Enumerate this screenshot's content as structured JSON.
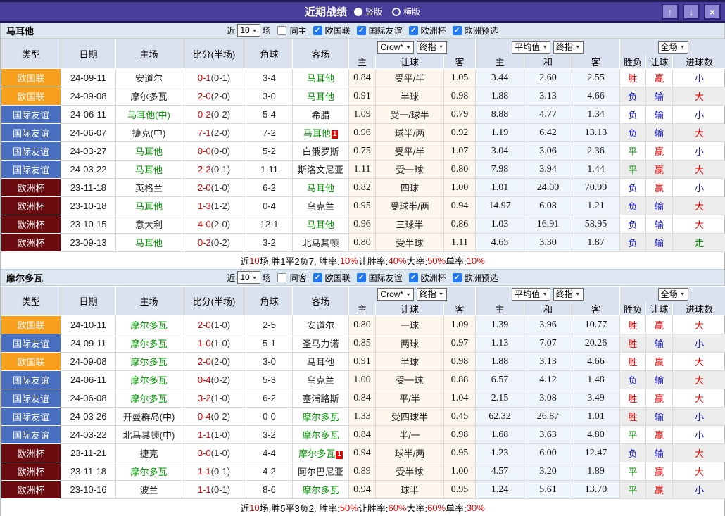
{
  "titlebar": {
    "title": "近期战绩",
    "radio_vertical": "竖版",
    "radio_horizontal": "横版",
    "up_button": "↑",
    "down_button": "↓",
    "close_button": "×"
  },
  "selects": {
    "near_count": "10",
    "crow": "Crow*",
    "final": "终指",
    "avg": "平均值",
    "scope": "全场"
  },
  "filter": {
    "near_label": "近",
    "games_label": "场",
    "leagues": [
      "欧国联",
      "国际友谊",
      "欧洲杯",
      "欧洲预选"
    ]
  },
  "header_labels": {
    "col_type": "类型",
    "col_date": "日期",
    "col_home": "主场",
    "col_score": "比分(半场)",
    "col_corner": "角球",
    "col_away": "客场",
    "sub": [
      "主",
      "让球",
      "客",
      "主",
      "和",
      "客",
      "胜负",
      "让球",
      "进球数"
    ]
  },
  "colors": {
    "titlebar_purple": "#483d9b",
    "league": {
      "欧国联": "#f8a01d",
      "国际友谊": "#4a6fc0",
      "欧洲杯": "#6b0d10"
    },
    "red": "#e60000",
    "blue": "#1414cc",
    "green": "#008800",
    "focal_green": "#009900"
  },
  "tables": [
    {
      "team": "马耳他",
      "same_label": "同主",
      "rows": [
        {
          "lg": "欧国联",
          "d": "24-09-11",
          "h": "安道尔",
          "s": "0-1",
          "sh": "(0-1)",
          "cn": "3-4",
          "a": "马耳他",
          "o": [
            "0.84",
            "受平/半",
            "1.05"
          ],
          "av": [
            "3.44",
            "2.60",
            "2.55"
          ],
          "r": [
            "胜",
            "赢",
            "小"
          ]
        },
        {
          "lg": "欧国联",
          "d": "24-09-08",
          "h": "摩尔多瓦",
          "s": "2-0",
          "sh": "(2-0)",
          "cn": "3-0",
          "a": "马耳他",
          "o": [
            "0.91",
            "半球",
            "0.98"
          ],
          "av": [
            "1.88",
            "3.13",
            "4.66"
          ],
          "r": [
            "负",
            "输",
            "大"
          ]
        },
        {
          "lg": "国际友谊",
          "d": "24-06-11",
          "h": "马耳他(中)",
          "s": "0-2",
          "sh": "(0-2)",
          "cn": "5-4",
          "a": "希腊",
          "o": [
            "1.09",
            "受一/球半",
            "0.79"
          ],
          "av": [
            "8.88",
            "4.77",
            "1.34"
          ],
          "r": [
            "负",
            "输",
            "小"
          ]
        },
        {
          "lg": "国际友谊",
          "d": "24-06-07",
          "h": "捷克(中)",
          "s": "7-1",
          "sh": "(2-0)",
          "cn": "7-2",
          "a": "马耳他",
          "ab": "1",
          "o": [
            "0.96",
            "球半/两",
            "0.92"
          ],
          "av": [
            "1.19",
            "6.42",
            "13.13"
          ],
          "r": [
            "负",
            "输",
            "大"
          ]
        },
        {
          "lg": "国际友谊",
          "d": "24-03-27",
          "h": "马耳他",
          "s": "0-0",
          "sh": "(0-0)",
          "cn": "5-2",
          "a": "白俄罗斯",
          "o": [
            "0.75",
            "受平/半",
            "1.07"
          ],
          "av": [
            "3.04",
            "3.06",
            "2.36"
          ],
          "r": [
            "平",
            "赢",
            "小"
          ]
        },
        {
          "lg": "国际友谊",
          "d": "24-03-22",
          "h": "马耳他",
          "s": "2-2",
          "sh": "(0-1)",
          "cn": "1-11",
          "a": "斯洛文尼亚",
          "o": [
            "1.11",
            "受一球",
            "0.80"
          ],
          "av": [
            "7.98",
            "3.94",
            "1.44"
          ],
          "r": [
            "平",
            "赢",
            "大"
          ]
        },
        {
          "lg": "欧洲杯",
          "d": "23-11-18",
          "h": "英格兰",
          "s": "2-0",
          "sh": "(1-0)",
          "cn": "6-2",
          "a": "马耳他",
          "o": [
            "0.82",
            "四球",
            "1.00"
          ],
          "av": [
            "1.01",
            "24.00",
            "70.99"
          ],
          "r": [
            "负",
            "赢",
            "小"
          ]
        },
        {
          "lg": "欧洲杯",
          "d": "23-10-18",
          "h": "马耳他",
          "s": "1-3",
          "sh": "(1-2)",
          "cn": "0-4",
          "a": "乌克兰",
          "o": [
            "0.95",
            "受球半/两",
            "0.94"
          ],
          "av": [
            "14.97",
            "6.08",
            "1.21"
          ],
          "r": [
            "负",
            "输",
            "大"
          ]
        },
        {
          "lg": "欧洲杯",
          "d": "23-10-15",
          "h": "意大利",
          "s": "4-0",
          "sh": "(2-0)",
          "cn": "12-1",
          "a": "马耳他",
          "o": [
            "0.96",
            "三球半",
            "0.86"
          ],
          "av": [
            "1.03",
            "16.91",
            "58.95"
          ],
          "r": [
            "负",
            "输",
            "大"
          ]
        },
        {
          "lg": "欧洲杯",
          "d": "23-09-13",
          "h": "马耳他",
          "s": "0-2",
          "sh": "(0-2)",
          "cn": "3-2",
          "a": "北马其顿",
          "o": [
            "0.80",
            "受半球",
            "1.11"
          ],
          "av": [
            "4.65",
            "3.30",
            "1.87"
          ],
          "r": [
            "负",
            "输",
            "走"
          ]
        }
      ],
      "summary_segments": [
        {
          "t": "近"
        },
        {
          "t": "10",
          "red": true
        },
        {
          "t": "场,胜1平2负7, 胜率:"
        },
        {
          "t": "10%",
          "red": true
        },
        {
          "t": " 让胜率:"
        },
        {
          "t": "40%",
          "red": true
        },
        {
          "t": " 大率:"
        },
        {
          "t": "50%",
          "red": true
        },
        {
          "t": " 单率:"
        },
        {
          "t": "10%",
          "red": true
        }
      ]
    },
    {
      "team": "摩尔多瓦",
      "same_label": "同客",
      "rows": [
        {
          "lg": "欧国联",
          "d": "24-10-11",
          "h": "摩尔多瓦",
          "s": "2-0",
          "sh": "(1-0)",
          "cn": "2-5",
          "a": "安道尔",
          "o": [
            "0.80",
            "一球",
            "1.09"
          ],
          "av": [
            "1.39",
            "3.96",
            "10.77"
          ],
          "r": [
            "胜",
            "赢",
            "大"
          ]
        },
        {
          "lg": "国际友谊",
          "d": "24-09-11",
          "h": "摩尔多瓦",
          "s": "1-0",
          "sh": "(1-0)",
          "cn": "5-1",
          "a": "圣马力诺",
          "o": [
            "0.85",
            "两球",
            "0.97"
          ],
          "av": [
            "1.13",
            "7.07",
            "20.26"
          ],
          "r": [
            "胜",
            "输",
            "小"
          ]
        },
        {
          "lg": "欧国联",
          "d": "24-09-08",
          "h": "摩尔多瓦",
          "s": "2-0",
          "sh": "(2-0)",
          "cn": "3-0",
          "a": "马耳他",
          "o": [
            "0.91",
            "半球",
            "0.98"
          ],
          "av": [
            "1.88",
            "3.13",
            "4.66"
          ],
          "r": [
            "胜",
            "赢",
            "大"
          ]
        },
        {
          "lg": "国际友谊",
          "d": "24-06-11",
          "h": "摩尔多瓦",
          "s": "0-4",
          "sh": "(0-2)",
          "cn": "5-3",
          "a": "乌克兰",
          "o": [
            "1.00",
            "受一球",
            "0.88"
          ],
          "av": [
            "6.57",
            "4.12",
            "1.48"
          ],
          "r": [
            "负",
            "输",
            "大"
          ]
        },
        {
          "lg": "国际友谊",
          "d": "24-06-08",
          "h": "摩尔多瓦",
          "s": "3-2",
          "sh": "(1-0)",
          "cn": "6-2",
          "a": "塞浦路斯",
          "o": [
            "0.84",
            "平/半",
            "1.04"
          ],
          "av": [
            "2.15",
            "3.08",
            "3.49"
          ],
          "r": [
            "胜",
            "赢",
            "大"
          ]
        },
        {
          "lg": "国际友谊",
          "d": "24-03-26",
          "h": "开曼群岛(中)",
          "s": "0-4",
          "sh": "(0-2)",
          "cn": "0-0",
          "a": "摩尔多瓦",
          "o": [
            "1.33",
            "受四球半",
            "0.45"
          ],
          "av": [
            "62.32",
            "26.87",
            "1.01"
          ],
          "r": [
            "胜",
            "输",
            "小"
          ]
        },
        {
          "lg": "国际友谊",
          "d": "24-03-22",
          "h": "北马其顿(中)",
          "s": "1-1",
          "sh": "(1-0)",
          "cn": "3-2",
          "a": "摩尔多瓦",
          "o": [
            "0.84",
            "半/一",
            "0.98"
          ],
          "av": [
            "1.68",
            "3.63",
            "4.80"
          ],
          "r": [
            "平",
            "赢",
            "小"
          ]
        },
        {
          "lg": "欧洲杯",
          "d": "23-11-21",
          "h": "捷克",
          "s": "3-0",
          "sh": "(1-0)",
          "cn": "4-4",
          "a": "摩尔多瓦",
          "ab": "1",
          "o": [
            "0.94",
            "球半/两",
            "0.95"
          ],
          "av": [
            "1.23",
            "6.00",
            "12.47"
          ],
          "r": [
            "负",
            "输",
            "大"
          ]
        },
        {
          "lg": "欧洲杯",
          "d": "23-11-18",
          "h": "摩尔多瓦",
          "s": "1-1",
          "sh": "(0-1)",
          "cn": "4-2",
          "a": "阿尔巴尼亚",
          "o": [
            "0.89",
            "受半球",
            "1.00"
          ],
          "av": [
            "4.57",
            "3.20",
            "1.89"
          ],
          "r": [
            "平",
            "赢",
            "大"
          ]
        },
        {
          "lg": "欧洲杯",
          "d": "23-10-16",
          "h": "波兰",
          "s": "1-1",
          "sh": "(0-1)",
          "cn": "8-6",
          "a": "摩尔多瓦",
          "o": [
            "0.94",
            "球半",
            "0.95"
          ],
          "av": [
            "1.24",
            "5.61",
            "13.70"
          ],
          "r": [
            "平",
            "赢",
            "小"
          ]
        }
      ],
      "summary_segments": [
        {
          "t": "近"
        },
        {
          "t": "10",
          "red": true
        },
        {
          "t": "场,胜5平3负2, 胜率:"
        },
        {
          "t": "50%",
          "red": true
        },
        {
          "t": " 让胜率:"
        },
        {
          "t": "60%",
          "red": true
        },
        {
          "t": " 大率:"
        },
        {
          "t": "60%",
          "red": true
        },
        {
          "t": " 单率:"
        },
        {
          "t": "30%",
          "red": true
        }
      ]
    }
  ]
}
